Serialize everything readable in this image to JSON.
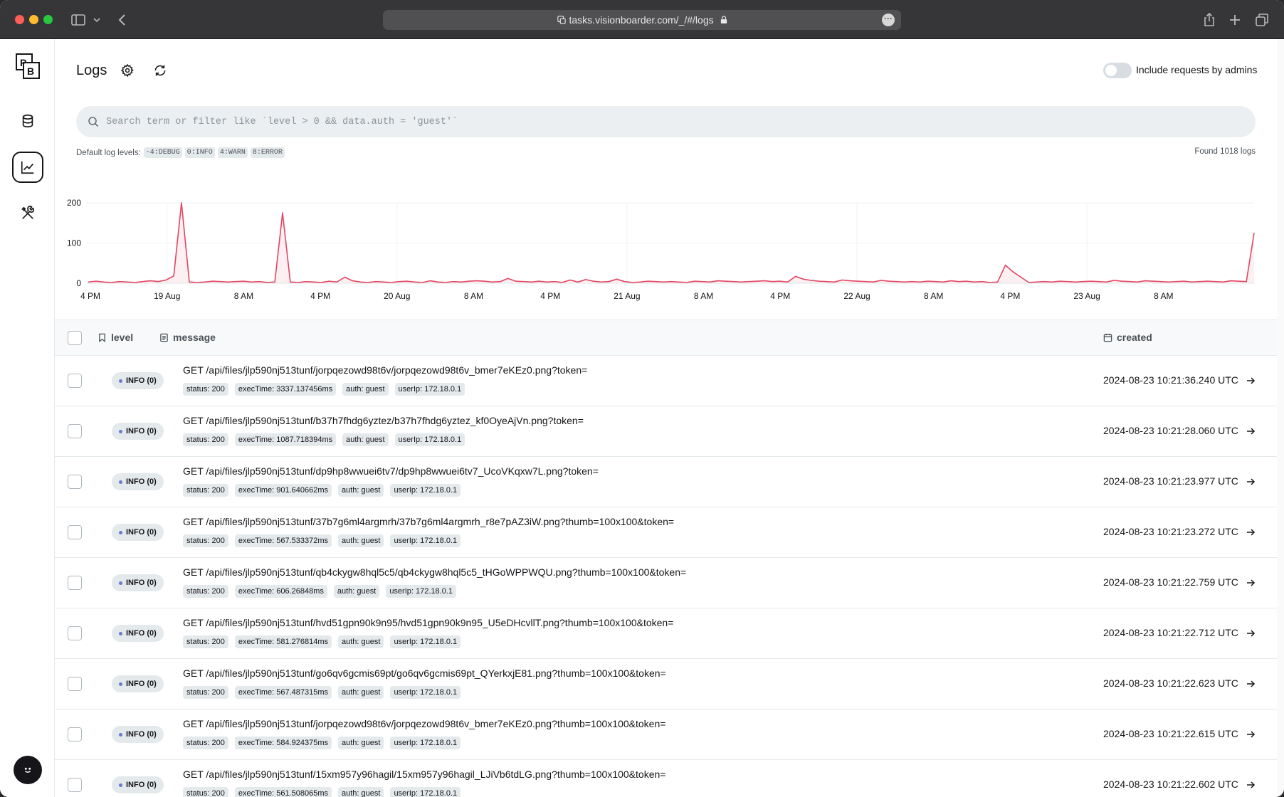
{
  "browser": {
    "url": "tasks.visionboarder.com/_/#/logs"
  },
  "sidebar": {
    "logo_letters": "PB",
    "items": [
      {
        "name": "collections"
      },
      {
        "name": "logs",
        "active": true
      },
      {
        "name": "settings"
      }
    ]
  },
  "header": {
    "title": "Logs",
    "toggle_label": "Include requests by admins",
    "toggle_on": false
  },
  "search": {
    "placeholder": "Search term or filter like `level > 0 && data.auth = 'guest'`",
    "value": ""
  },
  "levels": {
    "label": "Default log levels:",
    "items": [
      "-4:DEBUG",
      "0:INFO",
      "4:WARN",
      "8:ERROR"
    ]
  },
  "found_text": "Found 1018 logs",
  "chart_data": {
    "type": "area",
    "title": "",
    "xlabel": "",
    "ylabel": "",
    "ylim": [
      0,
      200
    ],
    "y_ticks": [
      "0",
      "100",
      "200"
    ],
    "x_ticks": [
      "4 PM",
      "19 Aug",
      "8 AM",
      "4 PM",
      "20 Aug",
      "8 AM",
      "4 PM",
      "21 Aug",
      "8 AM",
      "4 PM",
      "22 Aug",
      "8 AM",
      "4 PM",
      "23 Aug",
      "8 AM"
    ],
    "grid": true,
    "color": "#e34562",
    "values": [
      3,
      5,
      3,
      2,
      4,
      3,
      2,
      4,
      6,
      4,
      8,
      18,
      200,
      3,
      2,
      3,
      5,
      4,
      3,
      4,
      5,
      3,
      4,
      2,
      3,
      175,
      3,
      2,
      4,
      3,
      2,
      5,
      3,
      15,
      6,
      3,
      2,
      4,
      3,
      2,
      4,
      5,
      3,
      2,
      6,
      3,
      2,
      4,
      3,
      5,
      6,
      5,
      3,
      4,
      12,
      5,
      4,
      3,
      5,
      3,
      4,
      2,
      8,
      3,
      9,
      5,
      3,
      4,
      10,
      4,
      2,
      3,
      5,
      4,
      3,
      4,
      3,
      2,
      5,
      4,
      3,
      6,
      5,
      4,
      3,
      4,
      5,
      6,
      4,
      5,
      3,
      17,
      10,
      7,
      5,
      4,
      3,
      8,
      6,
      5,
      4,
      3,
      7,
      5,
      4,
      3,
      4,
      3,
      5,
      4,
      3,
      6,
      4,
      5,
      3,
      4,
      2,
      3,
      45,
      28,
      15,
      2,
      3,
      4,
      3,
      5,
      4,
      3,
      4,
      5,
      4,
      3,
      7,
      5,
      4,
      3,
      6,
      5,
      4,
      3,
      4,
      5,
      3,
      4,
      5,
      4,
      3,
      6,
      5,
      4,
      125
    ]
  },
  "table": {
    "columns": {
      "level": "level",
      "message": "message",
      "created": "created"
    },
    "rows": [
      {
        "level": "INFO (0)",
        "message": "GET /api/files/jlp590nj513tunf/jorpqezowd98t6v/jorpqezowd98t6v_bmer7eKEz0.png?token=",
        "tags": [
          "status: 200",
          "execTime: 3337.137456ms",
          "auth: guest",
          "userIp: 172.18.0.1"
        ],
        "created": "2024-08-23 10:21:36.240 UTC"
      },
      {
        "level": "INFO (0)",
        "message": "GET /api/files/jlp590nj513tunf/b37h7fhdg6yztez/b37h7fhdg6yztez_kf0OyeAjVn.png?token=",
        "tags": [
          "status: 200",
          "execTime: 1087.718394ms",
          "auth: guest",
          "userIp: 172.18.0.1"
        ],
        "created": "2024-08-23 10:21:28.060 UTC"
      },
      {
        "level": "INFO (0)",
        "message": "GET /api/files/jlp590nj513tunf/dp9hp8wwuei6tv7/dp9hp8wwuei6tv7_UcoVKqxw7L.png?token=",
        "tags": [
          "status: 200",
          "execTime: 901.640662ms",
          "auth: guest",
          "userIp: 172.18.0.1"
        ],
        "created": "2024-08-23 10:21:23.977 UTC"
      },
      {
        "level": "INFO (0)",
        "message": "GET /api/files/jlp590nj513tunf/37b7g6ml4argmrh/37b7g6ml4argmrh_r8e7pAZ3iW.png?thumb=100x100&token=",
        "tags": [
          "status: 200",
          "execTime: 567.533372ms",
          "auth: guest",
          "userIp: 172.18.0.1"
        ],
        "created": "2024-08-23 10:21:23.272 UTC"
      },
      {
        "level": "INFO (0)",
        "message": "GET /api/files/jlp590nj513tunf/qb4ckygw8hql5c5/qb4ckygw8hql5c5_tHGoWPPWQU.png?thumb=100x100&token=",
        "tags": [
          "status: 200",
          "execTime: 606.26848ms",
          "auth: guest",
          "userIp: 172.18.0.1"
        ],
        "created": "2024-08-23 10:21:22.759 UTC"
      },
      {
        "level": "INFO (0)",
        "message": "GET /api/files/jlp590nj513tunf/hvd51gpn90k9n95/hvd51gpn90k9n95_U5eDHcvllT.png?thumb=100x100&token=",
        "tags": [
          "status: 200",
          "execTime: 581.276814ms",
          "auth: guest",
          "userIp: 172.18.0.1"
        ],
        "created": "2024-08-23 10:21:22.712 UTC"
      },
      {
        "level": "INFO (0)",
        "message": "GET /api/files/jlp590nj513tunf/go6qv6gcmis69pt/go6qv6gcmis69pt_QYerkxjE81.png?thumb=100x100&token=",
        "tags": [
          "status: 200",
          "execTime: 567.487315ms",
          "auth: guest",
          "userIp: 172.18.0.1"
        ],
        "created": "2024-08-23 10:21:22.623 UTC"
      },
      {
        "level": "INFO (0)",
        "message": "GET /api/files/jlp590nj513tunf/jorpqezowd98t6v/jorpqezowd98t6v_bmer7eKEz0.png?thumb=100x100&token=",
        "tags": [
          "status: 200",
          "execTime: 584.924375ms",
          "auth: guest",
          "userIp: 172.18.0.1"
        ],
        "created": "2024-08-23 10:21:22.615 UTC"
      },
      {
        "level": "INFO (0)",
        "message": "GET /api/files/jlp590nj513tunf/15xm957y96hagil/15xm957y96hagil_LJiVb6tdLG.png?thumb=100x100&token=",
        "tags": [
          "status: 200",
          "execTime: 561.508065ms",
          "auth: guest",
          "userIp: 172.18.0.1"
        ],
        "created": "2024-08-23 10:21:22.602 UTC"
      }
    ]
  }
}
